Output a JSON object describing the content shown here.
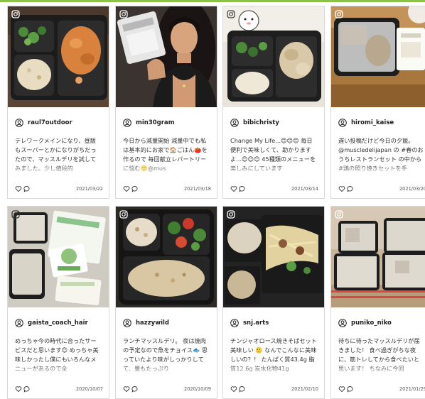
{
  "posts": [
    {
      "user": "raul7outdoor",
      "caption": "テレワークメインになり、昼飯もスーパーとかになりがちだったので、マッスルデリを試してみました。少し値段的",
      "date": "2021/03/22"
    },
    {
      "user": "min30gram",
      "caption": "今日から減量開始 減量中でも私は基本的にお家で🏠ごはん🍅を作るので 毎回献立レパートリーに悩む🙂@mus",
      "date": "2021/03/18"
    },
    {
      "user": "bibichristy",
      "caption": "Change My Life...😊😊😊 毎日便利で美味しくて、助かりますよ...😊😊😊 45種類のメニューを楽しみにしています",
      "date": "2021/03/14"
    },
    {
      "user": "hiromi_kaise",
      "caption": "遅い投稿だけど今日の夕飯。@muscledelijapan の #春のおうちレストランセット の中から#鶏の照り焼きセットを手",
      "date": "2021/03/20"
    },
    {
      "user": "gaista_coach_hair",
      "caption": "めっちゃ今の時代に合ったサービスだと思います😊 めっちゃ美味しかったし僕にもいろんなメニューがあるので全",
      "date": "2020/10/07"
    },
    {
      "user": "hazzywild",
      "caption": "ランチマッスルデリ。 夜は焼肉の予定なので魚をチョイス🐟 思っていたより味がしっかりしてて、量もたっぷり",
      "date": "2020/10/09"
    },
    {
      "user": "snj.arts",
      "caption": "チンジャオロース焼きそばセット 美味しい 🙂 なんでこんなに美味しいの？！ たんぱく質43.4g 脂質12.6g 炭水化物41g",
      "date": "2021/02/10"
    },
    {
      "user": "puniko_niko",
      "caption": "待ちに待ったマッスルデリが届きました！ 食べ過ぎがちな夜に、筋トレしてから食べたいと思います！ ちなみに今回",
      "date": "2021/01/29"
    }
  ],
  "colors": {
    "accent": "#8bc34a",
    "border": "#d8d8d8",
    "text": "#333333"
  },
  "icons": {
    "corner": "instagram-icon",
    "user": "user-circle-icon",
    "like": "heart-icon",
    "comment": "comment-icon"
  }
}
